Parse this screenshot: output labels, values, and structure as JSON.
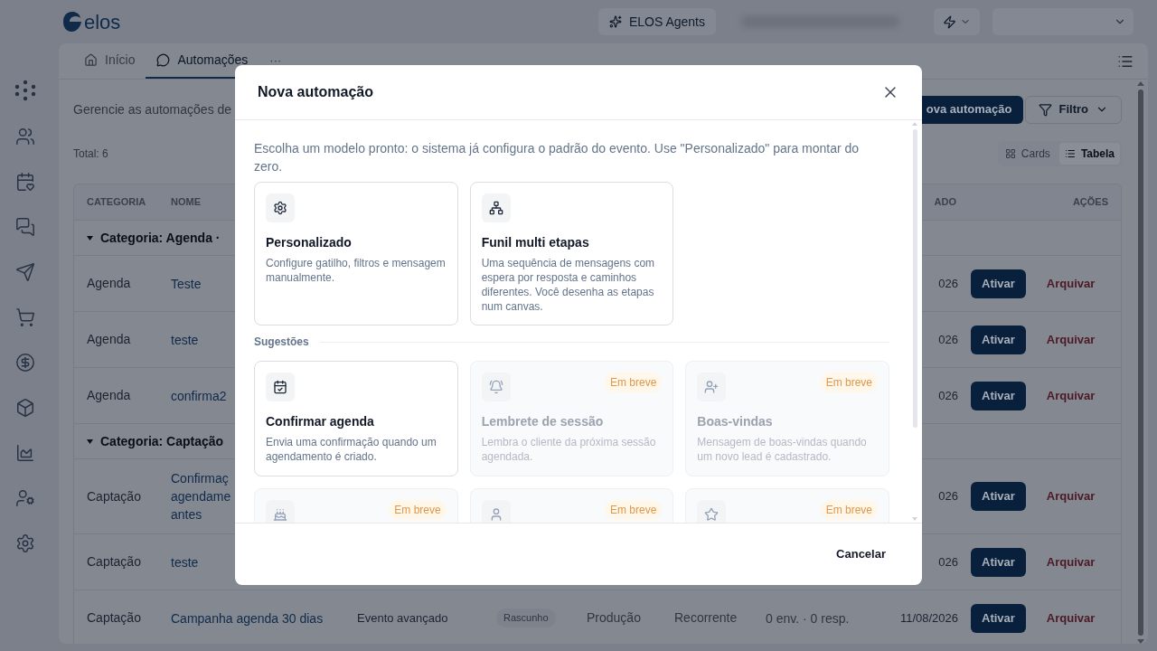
{
  "topbar": {
    "logo": "elos",
    "agents_button": "ELOS Agents"
  },
  "tabs": [
    {
      "label": "Início",
      "selected": false
    },
    {
      "label": "Automações",
      "selected": true
    }
  ],
  "tabs_more": "···",
  "description": "Gerencie as automações de",
  "new_button": "ova automação",
  "filter_button": "Filtro",
  "total": "Total: 6",
  "view_toggle": [
    {
      "label": "Cards",
      "selected": false
    },
    {
      "label": "Tabela",
      "selected": true
    }
  ],
  "table": {
    "columns": [
      "CATEGORIA",
      "NOME",
      "ADO",
      "AÇÕES"
    ],
    "groups": [
      {
        "label": "Categoria: Agenda ·",
        "rows": [
          {
            "category": "Agenda",
            "name": "Teste",
            "date": "026",
            "actions": [
              "Ativar",
              "Arquivar"
            ]
          },
          {
            "category": "Agenda",
            "name": "teste",
            "date": "026",
            "actions": [
              "Ativar",
              "Arquivar"
            ]
          },
          {
            "category": "Agenda",
            "name": "confirma2",
            "date": "026",
            "actions": [
              "Ativar",
              "Arquivar"
            ]
          }
        ]
      },
      {
        "label": "Categoria: Captação",
        "rows": [
          {
            "category": "Captação",
            "name": "Confirmaç\nagendame\nantes",
            "date": "026",
            "actions": [
              "Ativar",
              "Arquivar"
            ]
          },
          {
            "category": "Captação",
            "name": "teste",
            "date": "026",
            "actions": [
              "Ativar",
              "Arquivar"
            ]
          },
          {
            "category": "Captação",
            "name": "Campanha agenda 30 dias",
            "type": "Evento avançado",
            "status": "Rascunho",
            "environment": "Produção",
            "frequency": "Recorrente",
            "stats": "0 env. · 0 resp.",
            "date": "11/08/2026",
            "actions": [
              "Ativar",
              "Arquivar"
            ]
          }
        ]
      }
    ]
  },
  "modal": {
    "title": "Nova automação",
    "intro": "Escolha um modelo pronto: o sistema já configura o padrão do evento. Use \"Personalizado\" para montar do zero.",
    "templates": [
      {
        "title": "Personalizado",
        "description": "Configure gatilho, filtros e mensagem manualmente.",
        "disabled": false
      },
      {
        "title": "Funil multi etapas",
        "description": "Uma sequência de mensagens com espera por resposta e caminhos diferentes. Você desenha as etapas num canvas.",
        "disabled": false
      }
    ],
    "suggestions_label": "Sugestões",
    "suggestions": [
      {
        "title": "Confirmar agenda",
        "description": "Envia uma confirmação quando um agendamento é criado.",
        "disabled": false
      },
      {
        "title": "Lembrete de sessão",
        "description": "Lembra o cliente da próxima sessão agendada.",
        "disabled": true,
        "badge": "Em breve"
      },
      {
        "title": "Boas-vindas",
        "description": "Mensagem de boas-vindas quando um novo lead é cadastrado.",
        "disabled": true,
        "badge": "Em breve"
      },
      {
        "disabled": true,
        "badge": "Em breve"
      },
      {
        "disabled": true,
        "badge": "Em breve"
      },
      {
        "disabled": true,
        "badge": "Em breve"
      }
    ],
    "cancel_button": "Cancelar"
  }
}
